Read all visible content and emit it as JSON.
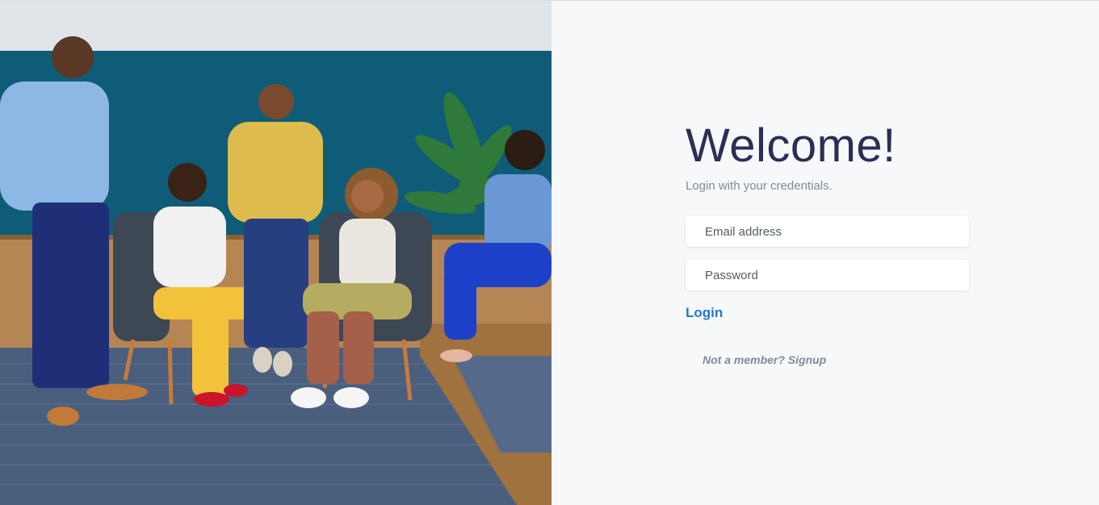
{
  "hero_image": {
    "icon": "team-photo",
    "colors": {
      "wall_top": "#dfe5e8",
      "wall_teal": "#0f5c78",
      "wood": "#b58653",
      "carpet": "#4a5f7e",
      "accent_yellow": "#f2c23a"
    }
  },
  "login": {
    "title": "Welcome!",
    "subtitle": "Login with your credentials.",
    "email_placeholder": "Email address",
    "email_value": "",
    "password_placeholder": "Password",
    "password_value": "",
    "login_label": "Login",
    "signup_label": "Not a member? Signup"
  },
  "colors": {
    "panel_bg": "#f7f8fa",
    "title": "#2b2f55",
    "muted": "#7f8b9a",
    "link": "#1e78d2"
  }
}
